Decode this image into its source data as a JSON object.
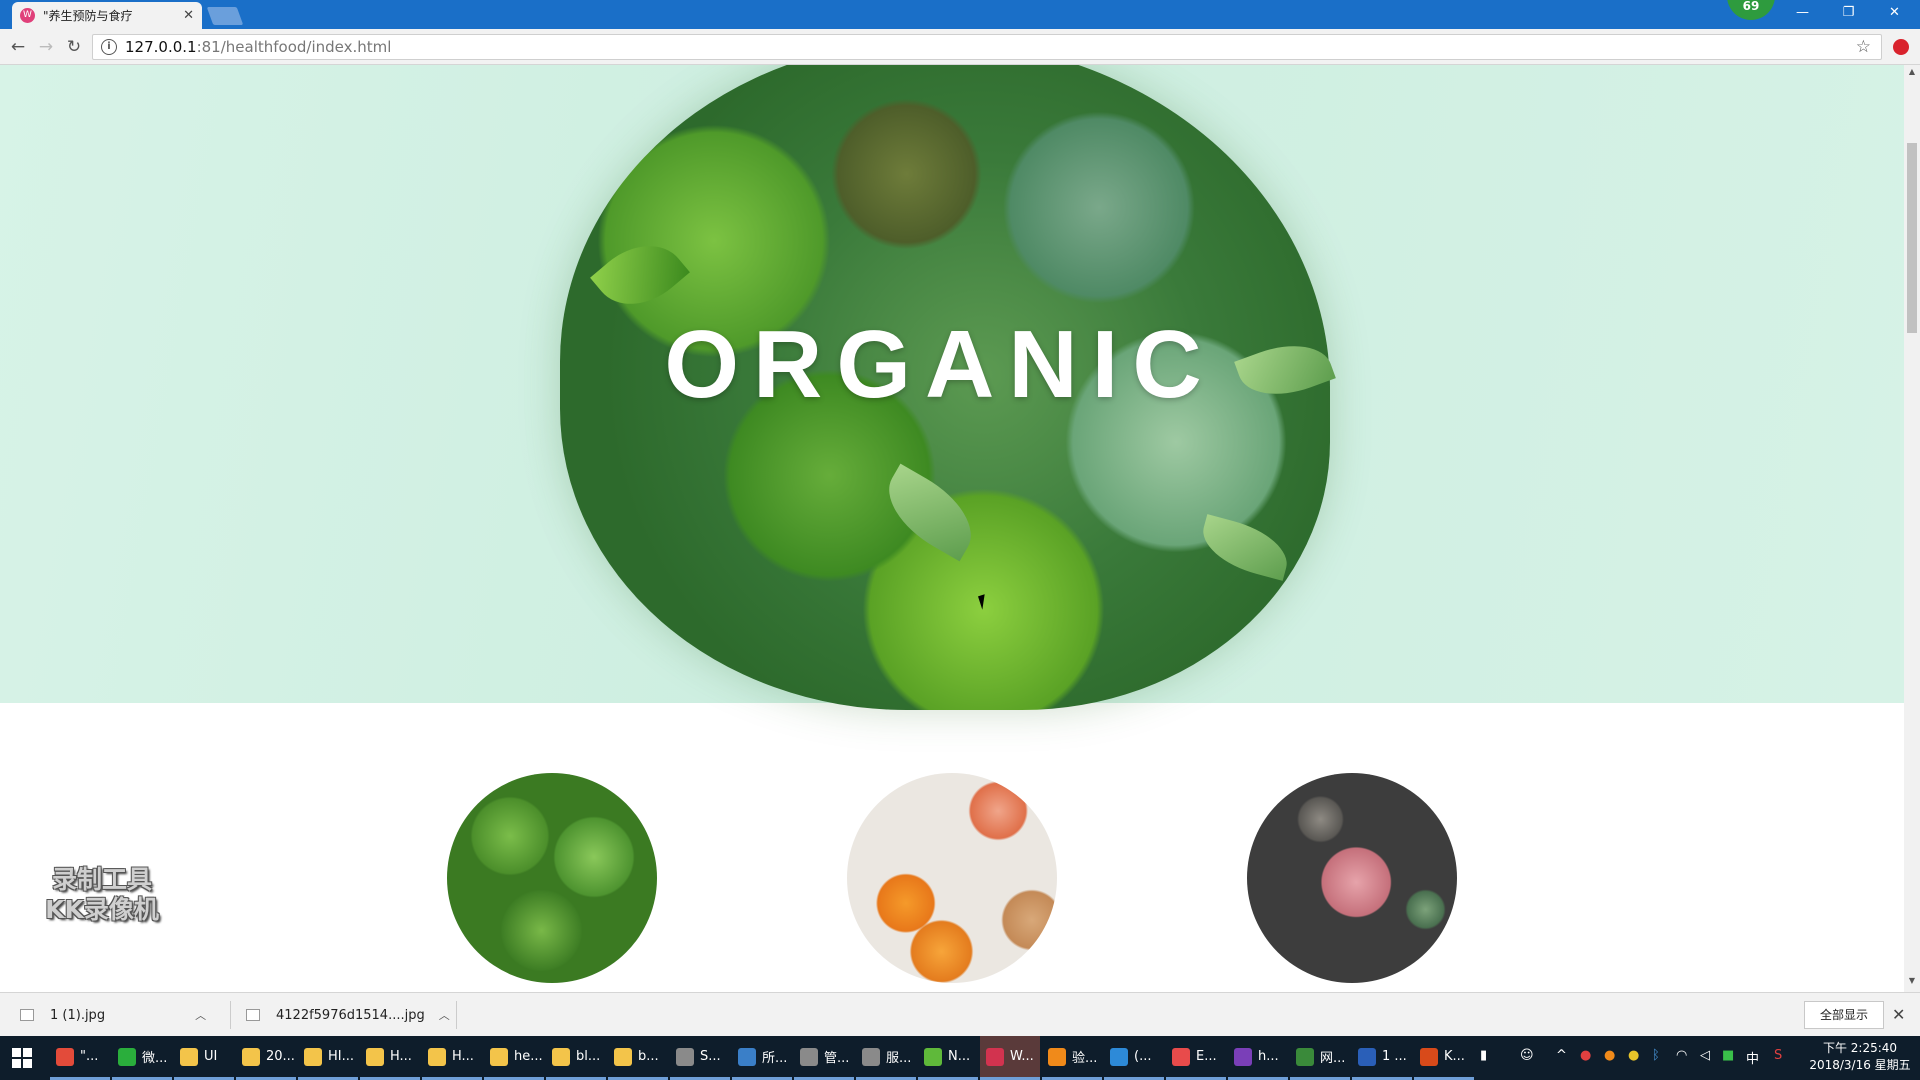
{
  "browser": {
    "tab_title": "\"养生预防与食疗",
    "tab_favicon": "W",
    "badge_count": "69",
    "url_host": "127.0.0.1",
    "url_path": ":81/healthfood/index.html"
  },
  "hero": {
    "title": "ORGANIC"
  },
  "watermark": {
    "line1": "录制工具",
    "line2": "KK录像机"
  },
  "downloads": {
    "items": [
      {
        "name": "1 (1).jpg"
      },
      {
        "name": "4122f5976d1514....jpg"
      }
    ],
    "show_all": "全部显示"
  },
  "taskbar": {
    "items": [
      {
        "label": "\"...",
        "color": "#e34b3a"
      },
      {
        "label": "微...",
        "color": "#2aae3c"
      },
      {
        "label": "UI",
        "color": "#f3c44a"
      },
      {
        "label": "20...",
        "color": "#f3c44a"
      },
      {
        "label": "HI...",
        "color": "#f3c44a"
      },
      {
        "label": "H...",
        "color": "#f3c44a"
      },
      {
        "label": "H...",
        "color": "#f3c44a"
      },
      {
        "label": "he...",
        "color": "#f3c44a"
      },
      {
        "label": "bl...",
        "color": "#f3c44a"
      },
      {
        "label": "b...",
        "color": "#f3c44a"
      },
      {
        "label": "S...",
        "color": "#8a8a8a"
      },
      {
        "label": "所...",
        "color": "#3a7fc8"
      },
      {
        "label": "管...",
        "color": "#8a8a8a"
      },
      {
        "label": "服...",
        "color": "#8a8a8a"
      },
      {
        "label": "N...",
        "color": "#5fb93a"
      },
      {
        "label": "W...",
        "color": "#d2334f"
      },
      {
        "label": "验...",
        "color": "#f08a1a"
      },
      {
        "label": "(...",
        "color": "#2d8ad8"
      },
      {
        "label": "E...",
        "color": "#e84b4b"
      },
      {
        "label": "h...",
        "color": "#7a3fb8"
      },
      {
        "label": "网...",
        "color": "#3a8a3a"
      },
      {
        "label": "1 ...",
        "color": "#2a5fb8"
      },
      {
        "label": "K...",
        "color": "#d84a1a"
      }
    ],
    "clock_time": "下午 2:25:40",
    "clock_date": "2018/3/16 星期五",
    "ime": "中"
  }
}
